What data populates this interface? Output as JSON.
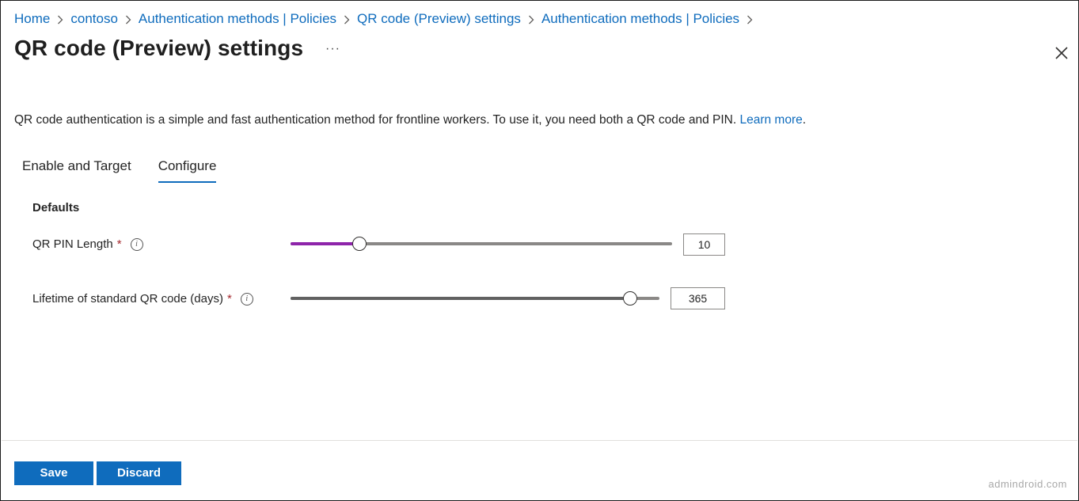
{
  "breadcrumb": [
    "Home",
    "contoso",
    "Authentication methods | Policies",
    "QR code (Preview) settings",
    "Authentication methods | Policies"
  ],
  "title": "QR code (Preview) settings",
  "more_label": "···",
  "description": {
    "text": "QR code authentication is a simple and fast authentication method for frontline workers. To use it, you need both a QR code and PIN.",
    "link": "Learn more",
    "tail": "."
  },
  "tabs": [
    {
      "label": "Enable and Target",
      "active": false
    },
    {
      "label": "Configure",
      "active": true
    }
  ],
  "defaults": {
    "heading": "Defaults",
    "pin_length": {
      "label": "QR PIN Length",
      "required_mark": "*",
      "info_icon": "i",
      "value": "10",
      "slider_fraction": 0.18,
      "accent_color": "#8e24aa"
    },
    "lifetime": {
      "label": "Lifetime of standard QR code (days)",
      "required_mark": "*",
      "info_icon": "i",
      "value": "365",
      "slider_fraction": 0.92,
      "accent_color": "#616161"
    }
  },
  "buttons": {
    "save": "Save",
    "discard": "Discard"
  },
  "watermark": "admindroid.com",
  "colors": {
    "accent": "#0f6cbd",
    "required": "#a4262c"
  }
}
